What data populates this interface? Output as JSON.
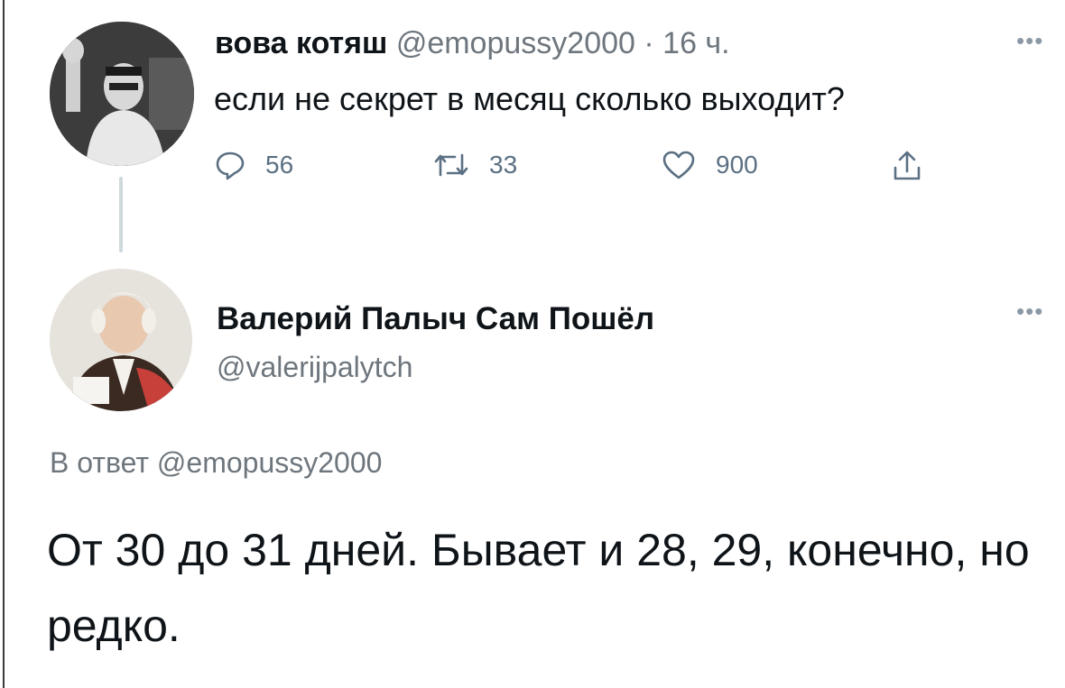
{
  "tweet1": {
    "author_name": "вова котяш",
    "handle": "@emopussy2000",
    "separator": "·",
    "time": "16 ч.",
    "more_icon": "more-dots-icon",
    "text": "если не секрет в месяц сколько выходит?",
    "actions": {
      "reply_count": "56",
      "retweet_count": "33",
      "like_count": "900"
    }
  },
  "tweet2": {
    "author_name": "Валерий Палыч Сам Пошёл",
    "handle": "@valerijpalytch",
    "more_icon": "more-dots-icon",
    "reply_prefix": "В ответ",
    "reply_handle": "@emopussy2000",
    "text": "От 30 до 31 дней. Бывает и 28, 29, конечно, но редко."
  },
  "colors": {
    "text": "#0f1419",
    "muted": "#6e767d",
    "thread_line": "#cfd9de"
  }
}
